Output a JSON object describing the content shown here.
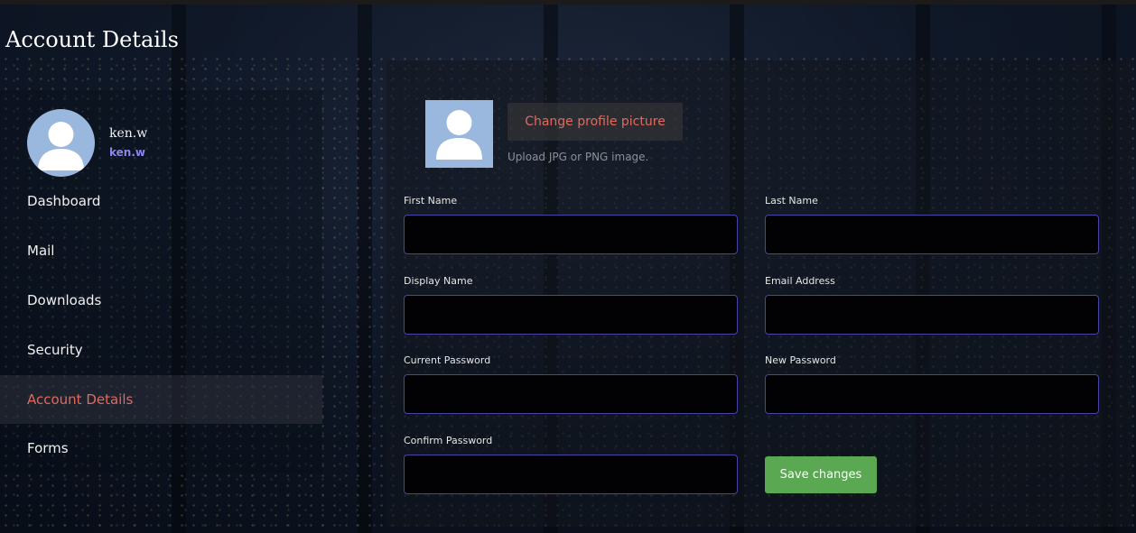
{
  "page": {
    "title": "Account Details"
  },
  "profile": {
    "name": "ken.w",
    "handle": "ken.w"
  },
  "sidebar": {
    "items": [
      {
        "label": "Dashboard"
      },
      {
        "label": "Mail"
      },
      {
        "label": "Downloads"
      },
      {
        "label": "Security"
      },
      {
        "label": "Account Details",
        "active": true
      },
      {
        "label": "Forms"
      }
    ]
  },
  "profile_picture": {
    "change_label": "Change profile picture",
    "hint": "Upload JPG or PNG image."
  },
  "form": {
    "first_name": {
      "label": "First Name",
      "value": ""
    },
    "last_name": {
      "label": "Last Name",
      "value": ""
    },
    "display_name": {
      "label": "Display Name",
      "value": ""
    },
    "email": {
      "label": "Email Address",
      "value": ""
    },
    "current_password": {
      "label": "Current Password",
      "value": ""
    },
    "new_password": {
      "label": "New Password",
      "value": ""
    },
    "confirm_password": {
      "label": "Confirm Password",
      "value": ""
    },
    "save_label": "Save changes"
  },
  "colors": {
    "accent": "#e06a5f",
    "handle": "#8c86e6",
    "input_border": "#4a43a6",
    "save": "#5aa852",
    "avatar_bg": "#9ab7dd"
  },
  "icons": {
    "avatar": "user-silhouette-icon"
  }
}
